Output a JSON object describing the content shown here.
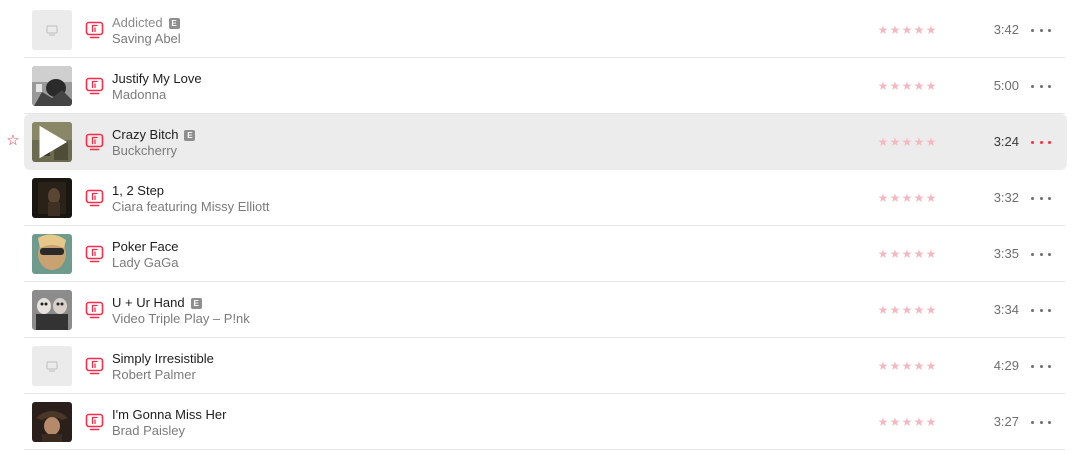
{
  "accent_color": "#fa2d48",
  "explicit_badge": "E",
  "songs": [
    {
      "title": "Addicted",
      "artist": "Saving Abel",
      "explicit": true,
      "duration": "3:42",
      "artwork": "placeholder-tv-icon",
      "unavailable": true
    },
    {
      "title": "Justify My Love",
      "artist": "Madonna",
      "explicit": false,
      "duration": "5:00",
      "artwork": "music-video-thumbnail"
    },
    {
      "title": "Crazy Bitch",
      "artist": "Buckcherry",
      "explicit": true,
      "duration": "3:24",
      "artwork": "music-video-thumbnail",
      "selected": true,
      "favorite": true,
      "playing_overlay": "play-icon"
    },
    {
      "title": "1, 2 Step",
      "artist": "Ciara featuring Missy Elliott",
      "explicit": false,
      "duration": "3:32",
      "artwork": "music-video-thumbnail"
    },
    {
      "title": "Poker Face",
      "artist": "Lady GaGa",
      "explicit": false,
      "duration": "3:35",
      "artwork": "music-video-thumbnail"
    },
    {
      "title": "U + Ur Hand",
      "artist": "Video Triple Play – P!nk",
      "explicit": true,
      "duration": "3:34",
      "artwork": "music-video-thumbnail"
    },
    {
      "title": "Simply Irresistible",
      "artist": "Robert Palmer",
      "explicit": false,
      "duration": "4:29",
      "artwork": "placeholder-tv-icon"
    },
    {
      "title": "I'm Gonna Miss Her",
      "artist": "Brad Paisley",
      "explicit": false,
      "duration": "3:27",
      "artwork": "music-video-thumbnail"
    }
  ],
  "rating_glyph": "★",
  "favorite_glyph": "☆",
  "rating_max": 5,
  "rating_value": 0
}
